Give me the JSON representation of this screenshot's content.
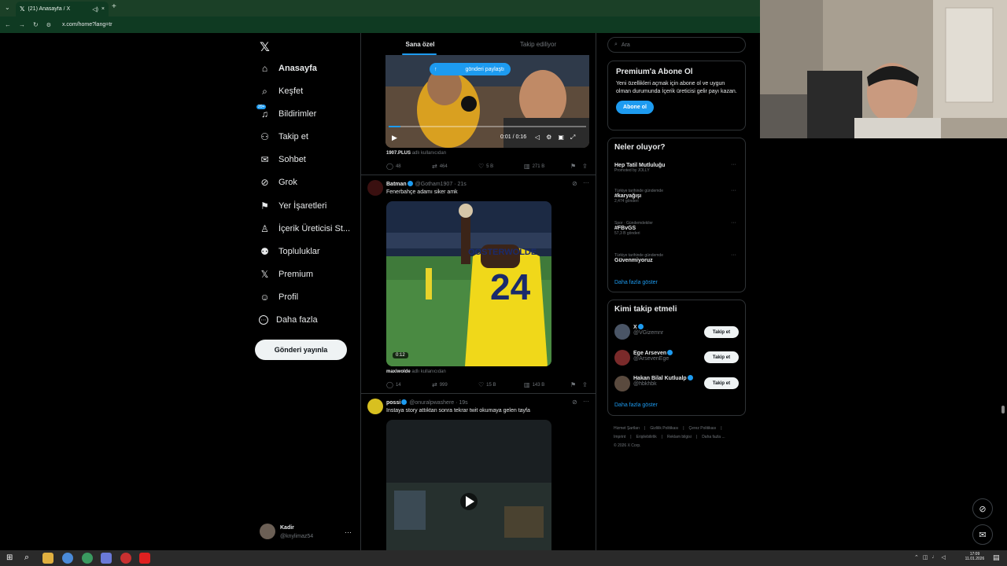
{
  "browser": {
    "tab_title": "(21) Anasayfa / X",
    "url": "x.com/home?lang=tr",
    "new_tab": "+",
    "close": "×"
  },
  "nav": {
    "items": [
      {
        "label": "Anasayfa",
        "icon": "home-icon",
        "glyph": "⌂"
      },
      {
        "label": "Keşfet",
        "icon": "search-icon",
        "glyph": "⌕"
      },
      {
        "label": "Bildirimler",
        "icon": "bell-icon",
        "glyph": "♫",
        "badge": "20+"
      },
      {
        "label": "Takip et",
        "icon": "add-person-icon",
        "glyph": "⚇"
      },
      {
        "label": "Sohbet",
        "icon": "mail-icon",
        "glyph": "✉"
      },
      {
        "label": "Grok",
        "icon": "grok-icon",
        "glyph": "⊘"
      },
      {
        "label": "Yer İşaretleri",
        "icon": "bookmark-icon",
        "glyph": "⚑"
      },
      {
        "label": "İçerik Üreticisi St...",
        "icon": "creator-icon",
        "glyph": "♙"
      },
      {
        "label": "Topluluklar",
        "icon": "communities-icon",
        "glyph": "⚉"
      },
      {
        "label": "Premium",
        "icon": "x-logo-icon",
        "glyph": "𝕏"
      },
      {
        "label": "Profil",
        "icon": "person-icon",
        "glyph": "☺"
      },
      {
        "label": "Daha fazla",
        "icon": "more-icon",
        "glyph": "⋯"
      }
    ],
    "post_button": "Gönderi yayınla",
    "account": {
      "name": "Kadir",
      "handle": "@knylimaz54",
      "more": "···"
    }
  },
  "feed": {
    "tabs": [
      "Sana özel",
      "Takip ediliyor"
    ],
    "tweet1": {
      "pill": "gönderi paylaştı",
      "video_time": "0:01 / 0:16",
      "source_user": "1907.PLUS",
      "source_suffix": "adlı kullanıcıdan",
      "stats": {
        "replies": "48",
        "retweets": "464",
        "likes": "5 B",
        "views": "271 B"
      }
    },
    "tweet2": {
      "name": "Batman",
      "handle": "@Gotham1907",
      "time": "· 21s",
      "text": "Fenerbahçe adamı siker amk",
      "jersey_name": "OOSTERWOLDE",
      "jersey_number": "24",
      "duration": "0:12",
      "source_user": "maxiwolde",
      "source_suffix": "adlı kullanıcıdan",
      "stats": {
        "replies": "14",
        "retweets": "999",
        "likes": "15 B",
        "views": "143 B"
      }
    },
    "tweet3": {
      "name": "possi",
      "handle": "@onuralpwashere",
      "time": "· 19s",
      "text": "Instaya story attıktan sonra tekrar twit okumaya gelen tayfa"
    }
  },
  "sidebar": {
    "search_placeholder": "Ara",
    "premium": {
      "title": "Premium'a Abone Ol",
      "body": "Yeni özellikleri açmak için abone ol ve uygun olman durumunda İçerik üreticisi gelir payı kazan.",
      "button": "Abone ol"
    },
    "trends": {
      "title": "Neler oluyor?",
      "items": [
        {
          "meta": "",
          "title": "Hep Tatil Mutluluğu",
          "sub": "Promoted by JOLLY"
        },
        {
          "meta": "Türkiye tarihinde gündemde",
          "title": "#karyağışı",
          "sub": "2,474 gönderi"
        },
        {
          "meta": "Spor · Gündemdekiler",
          "title": "#FBvGS",
          "sub": "57,3 B gönderi"
        },
        {
          "meta": "Türkiye tarihinde gündemde",
          "title": "Güvenmiyoruz",
          "sub": ""
        }
      ],
      "more": "Daha fazla göster"
    },
    "who_to_follow": {
      "title": "Kimi takip etmeli",
      "items": [
        {
          "name": "X",
          "handle": "@VGizemnr",
          "button": "Takip et"
        },
        {
          "name": "Ege Arseven",
          "handle": "@ArsevenEge",
          "button": "Takip et"
        },
        {
          "name": "Hakan Bilal Kutlualp",
          "handle": "@hbkhbk",
          "button": "Takip et"
        }
      ],
      "more": "Daha fazla göster"
    },
    "footer": {
      "row1": [
        "Hizmet Şartları",
        "Gizlilik Politikası",
        "Çerez Politikası"
      ],
      "row2": [
        "Imprint",
        "Erişilebilirlik",
        "Reklam bilgisi",
        "Daha fazla ..."
      ],
      "copyright": "© 2026 X Corp."
    }
  },
  "taskbar": {
    "time": "17:09",
    "date": "11.01.2026"
  },
  "colors": {
    "accent": "#1d9bf0",
    "chrome_green": "#1b4027",
    "border": "#2f3336"
  }
}
